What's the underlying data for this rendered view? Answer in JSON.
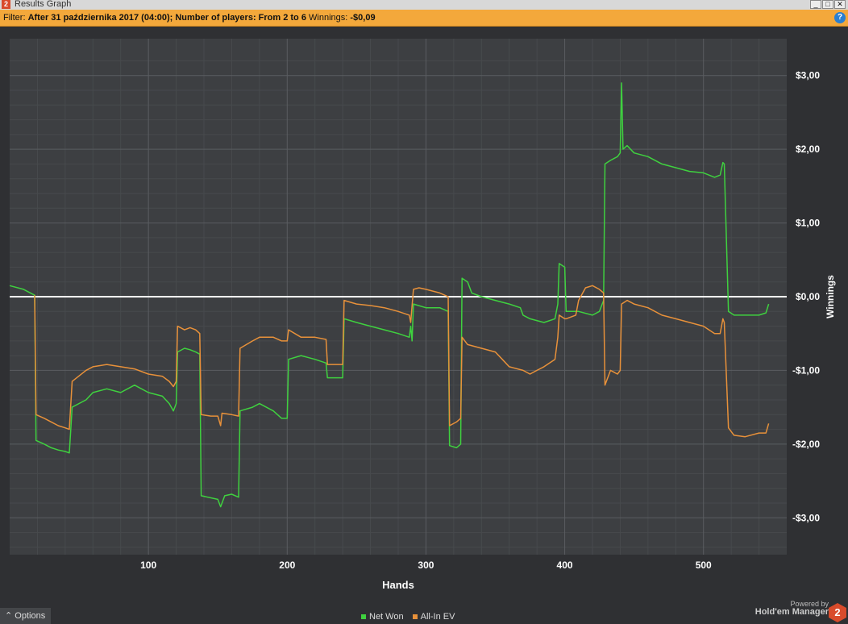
{
  "window": {
    "title": "Results Graph",
    "app_icon_text": "2"
  },
  "filter": {
    "label": "Filter:",
    "value": "After 31 października 2017 (04:00); Number of players: From 2 to 6",
    "winnings_label": "Winnings:",
    "winnings_value": "-$0,09"
  },
  "help_icon": "?",
  "chart_data": {
    "type": "line",
    "xlabel": "Hands",
    "ylabel": "Winnings",
    "xlim": [
      0,
      560
    ],
    "ylim": [
      -3.5,
      3.5
    ],
    "x_ticks": [
      100,
      200,
      300,
      400,
      500
    ],
    "x_tick_labels": [
      "100",
      "200",
      "300",
      "400",
      "500"
    ],
    "y_ticks": [
      3,
      2,
      1,
      0,
      -1,
      -2,
      -3
    ],
    "y_tick_labels": [
      "$3,00",
      "$2,00",
      "$1,00",
      "$0,00",
      "-$1,00",
      "-$2,00",
      "-$3,00"
    ],
    "grid": true,
    "series": [
      {
        "name": "Net Won",
        "color": "#3fd13f",
        "points": [
          [
            0,
            0.15
          ],
          [
            10,
            0.1
          ],
          [
            18,
            0.02
          ],
          [
            19,
            -1.95
          ],
          [
            25,
            -2.0
          ],
          [
            30,
            -2.05
          ],
          [
            35,
            -2.08
          ],
          [
            40,
            -2.1
          ],
          [
            43,
            -2.12
          ],
          [
            45,
            -1.5
          ],
          [
            55,
            -1.4
          ],
          [
            60,
            -1.3
          ],
          [
            70,
            -1.25
          ],
          [
            80,
            -1.3
          ],
          [
            90,
            -1.2
          ],
          [
            100,
            -1.3
          ],
          [
            110,
            -1.35
          ],
          [
            115,
            -1.45
          ],
          [
            118,
            -1.55
          ],
          [
            120,
            -1.45
          ],
          [
            121,
            -0.75
          ],
          [
            126,
            -0.7
          ],
          [
            130,
            -0.72
          ],
          [
            134,
            -0.75
          ],
          [
            137,
            -0.78
          ],
          [
            138,
            -2.7
          ],
          [
            150,
            -2.75
          ],
          [
            152,
            -2.85
          ],
          [
            155,
            -2.7
          ],
          [
            160,
            -2.68
          ],
          [
            165,
            -2.72
          ],
          [
            166,
            -1.55
          ],
          [
            175,
            -1.5
          ],
          [
            180,
            -1.45
          ],
          [
            190,
            -1.55
          ],
          [
            196,
            -1.65
          ],
          [
            200,
            -1.65
          ],
          [
            201,
            -0.85
          ],
          [
            210,
            -0.8
          ],
          [
            220,
            -0.85
          ],
          [
            228,
            -0.9
          ],
          [
            229,
            -1.1
          ],
          [
            240,
            -1.1
          ],
          [
            241,
            -0.3
          ],
          [
            250,
            -0.35
          ],
          [
            260,
            -0.4
          ],
          [
            270,
            -0.45
          ],
          [
            280,
            -0.5
          ],
          [
            288,
            -0.55
          ],
          [
            289,
            -0.4
          ],
          [
            290,
            -0.6
          ],
          [
            291,
            -0.1
          ],
          [
            300,
            -0.15
          ],
          [
            310,
            -0.15
          ],
          [
            316,
            -0.2
          ],
          [
            317,
            -2.02
          ],
          [
            322,
            -2.05
          ],
          [
            325,
            -2.0
          ],
          [
            326,
            0.25
          ],
          [
            330,
            0.2
          ],
          [
            333,
            0.05
          ],
          [
            340,
            0.0
          ],
          [
            350,
            -0.05
          ],
          [
            360,
            -0.1
          ],
          [
            368,
            -0.15
          ],
          [
            370,
            -0.25
          ],
          [
            375,
            -0.3
          ],
          [
            385,
            -0.35
          ],
          [
            393,
            -0.3
          ],
          [
            395,
            -0.1
          ],
          [
            396,
            0.45
          ],
          [
            400,
            0.4
          ],
          [
            401,
            -0.2
          ],
          [
            410,
            -0.2
          ],
          [
            420,
            -0.25
          ],
          [
            425,
            -0.2
          ],
          [
            428,
            -0.05
          ],
          [
            429,
            1.8
          ],
          [
            433,
            1.85
          ],
          [
            438,
            1.9
          ],
          [
            440,
            1.95
          ],
          [
            441,
            2.9
          ],
          [
            442,
            2.0
          ],
          [
            445,
            2.05
          ],
          [
            450,
            1.95
          ],
          [
            460,
            1.9
          ],
          [
            470,
            1.8
          ],
          [
            480,
            1.75
          ],
          [
            490,
            1.7
          ],
          [
            500,
            1.68
          ],
          [
            508,
            1.62
          ],
          [
            512,
            1.65
          ],
          [
            514,
            1.82
          ],
          [
            515,
            1.8
          ],
          [
            518,
            -0.2
          ],
          [
            522,
            -0.25
          ],
          [
            530,
            -0.25
          ],
          [
            540,
            -0.25
          ],
          [
            545,
            -0.22
          ],
          [
            547,
            -0.1
          ]
        ]
      },
      {
        "name": "All-In EV",
        "color": "#e8913a",
        "points": [
          [
            18,
            0.02
          ],
          [
            19,
            -1.6
          ],
          [
            25,
            -1.65
          ],
          [
            30,
            -1.7
          ],
          [
            35,
            -1.75
          ],
          [
            40,
            -1.78
          ],
          [
            43,
            -1.8
          ],
          [
            45,
            -1.15
          ],
          [
            55,
            -1.0
          ],
          [
            60,
            -0.95
          ],
          [
            70,
            -0.92
          ],
          [
            80,
            -0.95
          ],
          [
            90,
            -0.98
          ],
          [
            100,
            -1.05
          ],
          [
            110,
            -1.08
          ],
          [
            115,
            -1.15
          ],
          [
            118,
            -1.22
          ],
          [
            120,
            -1.15
          ],
          [
            121,
            -0.4
          ],
          [
            126,
            -0.45
          ],
          [
            130,
            -0.42
          ],
          [
            134,
            -0.45
          ],
          [
            137,
            -0.5
          ],
          [
            138,
            -1.6
          ],
          [
            145,
            -1.62
          ],
          [
            150,
            -1.62
          ],
          [
            152,
            -1.75
          ],
          [
            153,
            -1.58
          ],
          [
            160,
            -1.6
          ],
          [
            165,
            -1.62
          ],
          [
            166,
            -0.7
          ],
          [
            175,
            -0.6
          ],
          [
            180,
            -0.55
          ],
          [
            190,
            -0.55
          ],
          [
            196,
            -0.6
          ],
          [
            200,
            -0.6
          ],
          [
            201,
            -0.45
          ],
          [
            210,
            -0.55
          ],
          [
            220,
            -0.55
          ],
          [
            228,
            -0.58
          ],
          [
            229,
            -0.92
          ],
          [
            240,
            -0.92
          ],
          [
            241,
            -0.05
          ],
          [
            250,
            -0.1
          ],
          [
            260,
            -0.12
          ],
          [
            270,
            -0.15
          ],
          [
            280,
            -0.2
          ],
          [
            288,
            -0.25
          ],
          [
            289,
            -0.35
          ],
          [
            291,
            0.1
          ],
          [
            295,
            0.12
          ],
          [
            300,
            0.1
          ],
          [
            310,
            0.05
          ],
          [
            316,
            0.0
          ],
          [
            317,
            -1.75
          ],
          [
            322,
            -1.7
          ],
          [
            325,
            -1.65
          ],
          [
            326,
            -0.55
          ],
          [
            330,
            -0.65
          ],
          [
            340,
            -0.7
          ],
          [
            350,
            -0.75
          ],
          [
            355,
            -0.85
          ],
          [
            360,
            -0.95
          ],
          [
            370,
            -1.0
          ],
          [
            375,
            -1.05
          ],
          [
            380,
            -1.0
          ],
          [
            385,
            -0.95
          ],
          [
            393,
            -0.85
          ],
          [
            395,
            -0.55
          ],
          [
            396,
            -0.25
          ],
          [
            400,
            -0.3
          ],
          [
            401,
            -0.3
          ],
          [
            408,
            -0.25
          ],
          [
            410,
            -0.05
          ],
          [
            415,
            0.12
          ],
          [
            420,
            0.15
          ],
          [
            425,
            0.1
          ],
          [
            428,
            0.05
          ],
          [
            429,
            -1.2
          ],
          [
            433,
            -1.0
          ],
          [
            438,
            -1.05
          ],
          [
            440,
            -1.0
          ],
          [
            441,
            -0.1
          ],
          [
            445,
            -0.05
          ],
          [
            450,
            -0.1
          ],
          [
            460,
            -0.15
          ],
          [
            470,
            -0.25
          ],
          [
            480,
            -0.3
          ],
          [
            490,
            -0.35
          ],
          [
            500,
            -0.4
          ],
          [
            508,
            -0.5
          ],
          [
            512,
            -0.5
          ],
          [
            514,
            -0.3
          ],
          [
            515,
            -0.35
          ],
          [
            518,
            -1.78
          ],
          [
            522,
            -1.88
          ],
          [
            530,
            -1.9
          ],
          [
            540,
            -1.85
          ],
          [
            545,
            -1.85
          ],
          [
            547,
            -1.72
          ]
        ]
      }
    ]
  },
  "options_button": {
    "label": "Options",
    "icon": "caret-up-icon"
  },
  "legend": {
    "items": [
      {
        "label": "Net Won",
        "color": "#3fd13f"
      },
      {
        "label": "All-In EV",
        "color": "#e8913a"
      }
    ]
  },
  "branding": {
    "small": "Powered by",
    "big": "Hold'em Manager",
    "logo_text": "2"
  }
}
